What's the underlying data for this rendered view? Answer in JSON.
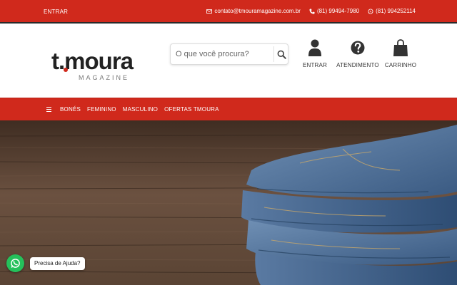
{
  "topbar": {
    "login": "ENTRAR",
    "email": "contato@tmouramagazine.com.br",
    "phone": "(81) 99494-7980",
    "whatsapp": "(81) 994252114"
  },
  "logo": {
    "main": "t.moura",
    "sub": "MAGAZINE"
  },
  "search": {
    "placeholder": "O que você procura?"
  },
  "header_nav": [
    {
      "label": "ENTRAR",
      "icon": "user-icon"
    },
    {
      "label": "ATENDIMENTO",
      "icon": "question-icon"
    },
    {
      "label": "CARRINHO",
      "icon": "shopping-bag-icon"
    }
  ],
  "menu": {
    "icon": "menu-icon",
    "items": [
      "BONÉS",
      "FEMININO",
      "MASCULINO",
      "OFERTAS TMOURA"
    ]
  },
  "whatsapp_widget": {
    "label": "Precisa de Ajuda?",
    "icon": "whatsapp-icon"
  },
  "colors": {
    "brand_red": "#d0291c",
    "whatsapp_green": "#25c15b",
    "text_dark": "#222222"
  }
}
